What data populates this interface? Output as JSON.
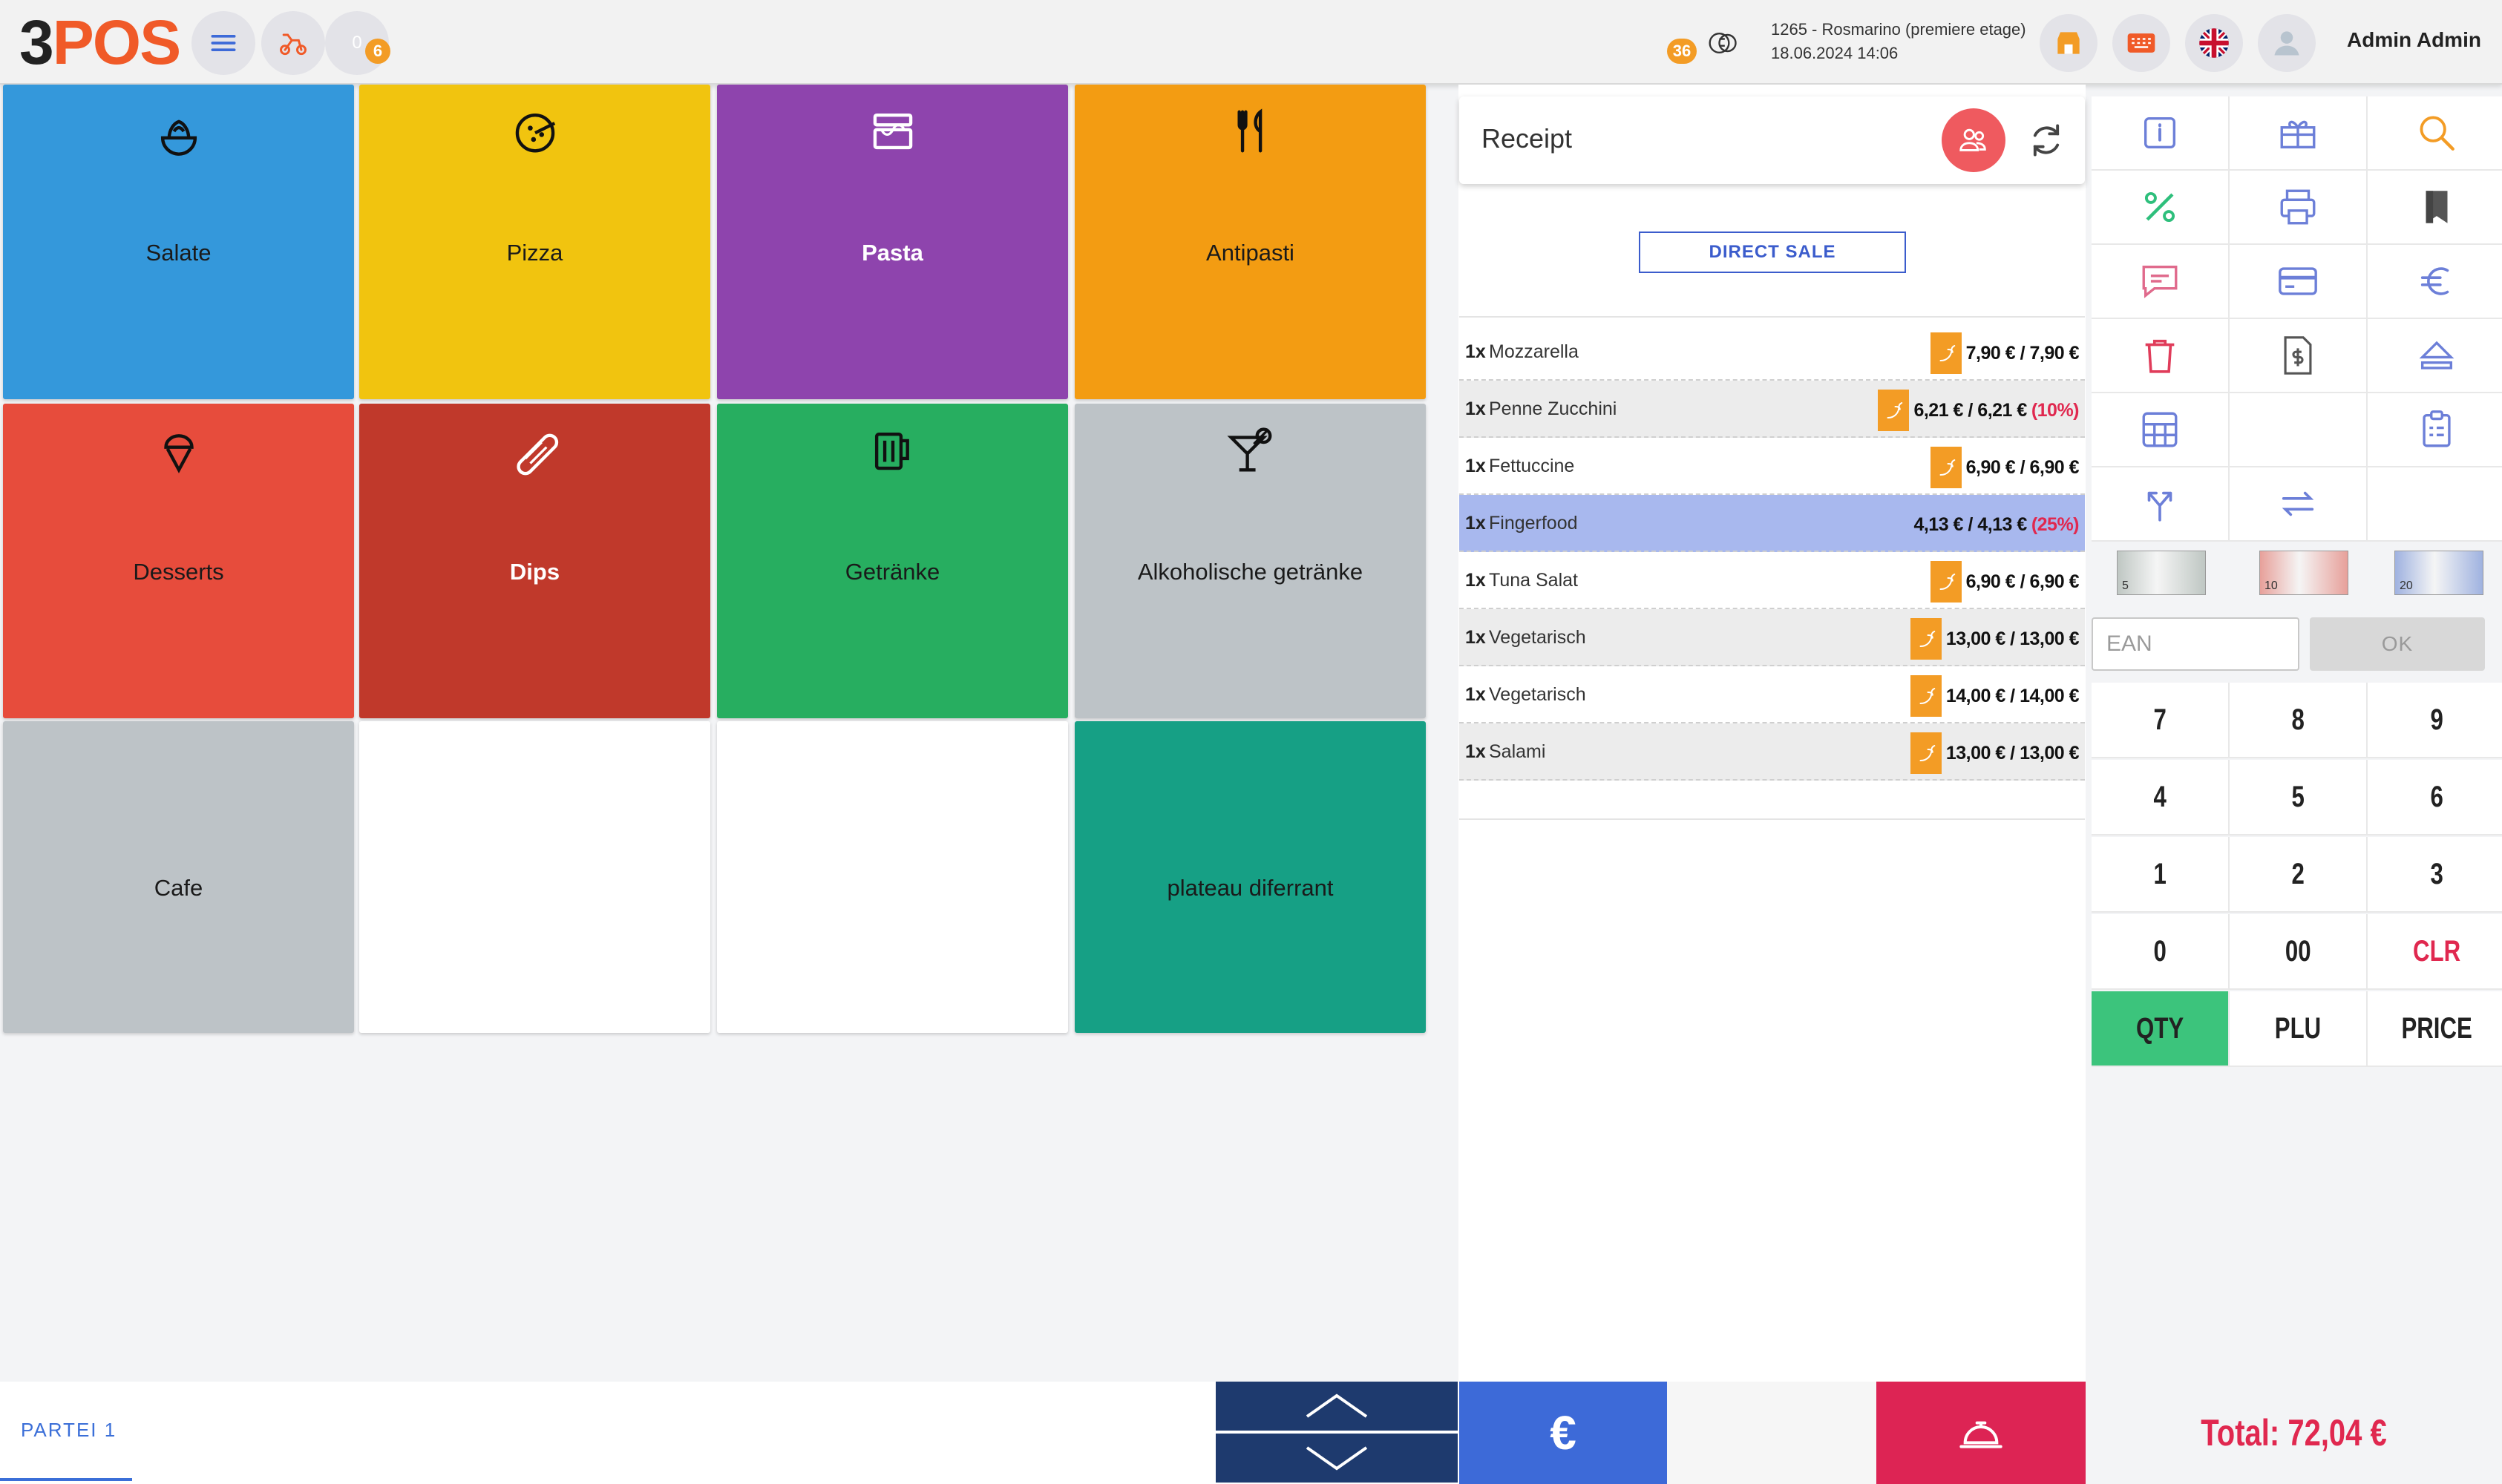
{
  "header": {
    "logo_num": "3",
    "logo_text": "POS",
    "clock_count": "0",
    "orders_badge": "6",
    "notif_badge": "36",
    "location": "1265 - Rosmarino (premiere etage)",
    "datetime": "18.06.2024 14:06",
    "user": "Admin Admin"
  },
  "categories": [
    {
      "label": "Salate",
      "color": "#3498db",
      "icon": "salad-bowl-icon",
      "text_color": "#1a1a1a"
    },
    {
      "label": "Pizza",
      "color": "#f1c40f",
      "icon": "pizza-icon",
      "text_color": "#1a1a1a"
    },
    {
      "label": "Pasta",
      "color": "#8e44ad",
      "icon": "noodles-box-icon",
      "text_color": "#ffffff"
    },
    {
      "label": "Antipasti",
      "color": "#f39c12",
      "icon": "cutlery-icon",
      "text_color": "#1a1a1a"
    },
    {
      "label": "Desserts",
      "color": "#e74c3c",
      "icon": "ice-cream-icon",
      "text_color": "#1a1a1a"
    },
    {
      "label": "Dips",
      "color": "#c0392b",
      "icon": "hotdog-icon",
      "text_color": "#ffffff"
    },
    {
      "label": "Getränke",
      "color": "#27ae60",
      "icon": "beer-mug-icon",
      "text_color": "#1a1a1a"
    },
    {
      "label": "Alkoholische getränke",
      "color": "#bdc3c7",
      "icon": "cocktail-icon",
      "text_color": "#1a1a1a"
    },
    {
      "label": "Cafe",
      "color": "#bdc3c7",
      "icon": "",
      "text_color": "#1a1a1a"
    },
    {
      "label": "",
      "color": "#ffffff",
      "icon": "",
      "text_color": "#1a1a1a"
    },
    {
      "label": "",
      "color": "#ffffff",
      "icon": "",
      "text_color": "#1a1a1a"
    },
    {
      "label": "plateau diferrant",
      "color": "#16a085",
      "icon": "",
      "text_color": "#1a1a1a"
    }
  ],
  "receipt": {
    "title": "Receipt",
    "direct_sale": "DIRECT SALE",
    "items": [
      {
        "qty": "1x",
        "name": "Mozzarella",
        "price": "7,90 € / 7,90 €",
        "discount": ""
      },
      {
        "qty": "1x",
        "name": "Penne Zucchini",
        "price": "6,21 € / 6,21 €",
        "discount": "(10%)"
      },
      {
        "qty": "1x",
        "name": "Fettuccine",
        "price": "6,90 € / 6,90 €",
        "discount": ""
      },
      {
        "qty": "1x",
        "name": "Fingerfood",
        "price": "4,13 € / 4,13 €",
        "discount": "(25%)"
      },
      {
        "qty": "1x",
        "name": "Tuna Salat",
        "price": "6,90 € / 6,90 €",
        "discount": ""
      },
      {
        "qty": "1x",
        "name": "Vegetarisch",
        "price": "13,00 € / 13,00 €",
        "discount": ""
      },
      {
        "qty": "1x",
        "name": "Vegetarisch",
        "price": "14,00 € / 14,00 €",
        "discount": ""
      },
      {
        "qty": "1x",
        "name": "Salami",
        "price": "13,00 € / 13,00 €",
        "discount": ""
      }
    ]
  },
  "keypad": {
    "ean_placeholder": "EAN",
    "ok": "OK",
    "keys": [
      "7",
      "8",
      "9",
      "4",
      "5",
      "6",
      "1",
      "2",
      "3",
      "0",
      "00",
      "CLR",
      "QTY",
      "PLU",
      "PRICE"
    ]
  },
  "banknotes": [
    "5",
    "10",
    "20"
  ],
  "bottom": {
    "party": "PARTEI 1",
    "euro": "€",
    "total": "Total: 72,04 €"
  },
  "colors": {
    "accent_blue": "#3d6ad8",
    "accent_red": "#dd2454",
    "navy": "#1e3a6e",
    "orange": "#f39c25",
    "green": "#3cc47c"
  }
}
